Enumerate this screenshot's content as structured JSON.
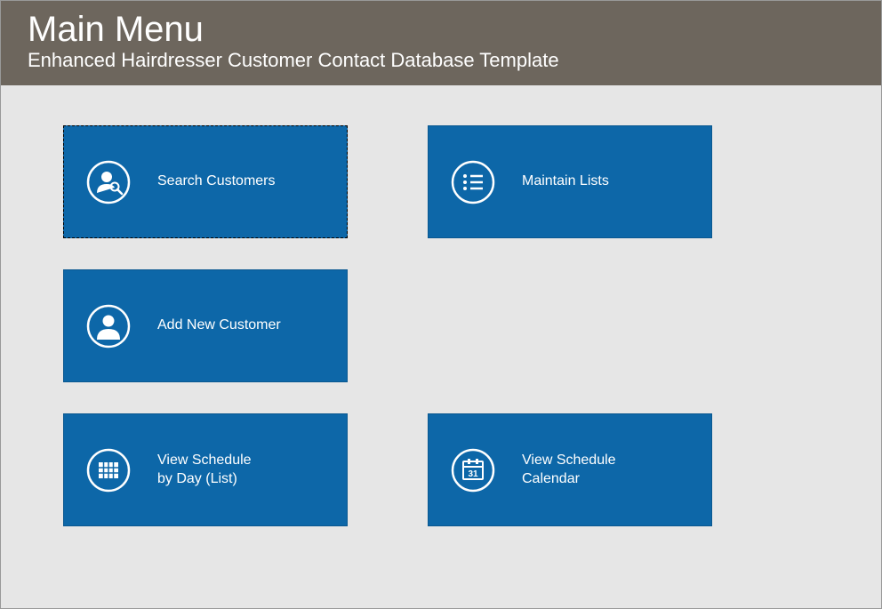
{
  "header": {
    "title": "Main Menu",
    "subtitle": "Enhanced Hairdresser Customer Contact Database Template"
  },
  "tiles": {
    "search_customers": {
      "label": "Search Customers"
    },
    "maintain_lists": {
      "label": "Maintain Lists"
    },
    "add_customer": {
      "label": "Add New Customer"
    },
    "schedule_day": {
      "label": "View Schedule\nby Day (List)"
    },
    "schedule_cal": {
      "label": "View Schedule\nCalendar"
    }
  },
  "colors": {
    "header_bg": "#6d665d",
    "tile_bg": "#0d67a8",
    "page_bg": "#e6e6e6"
  }
}
